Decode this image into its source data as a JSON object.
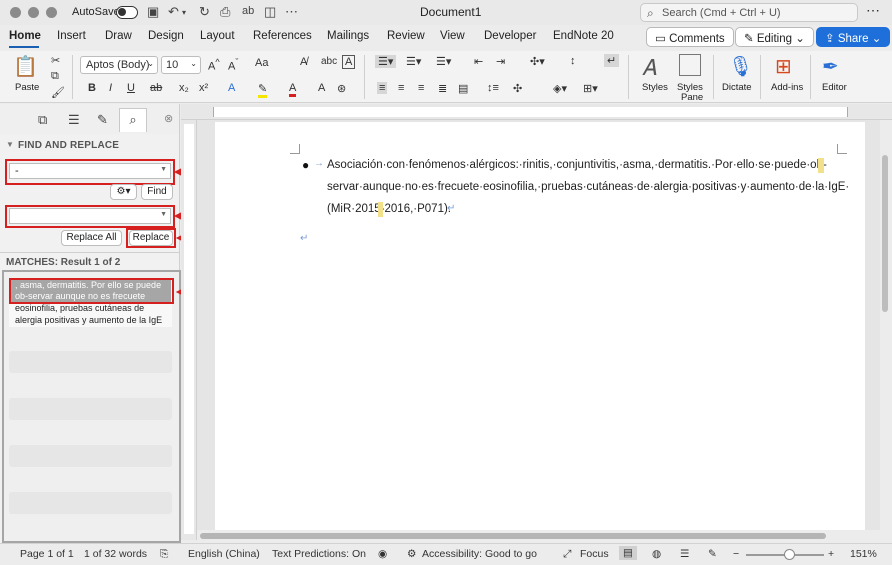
{
  "titlebar": {
    "autosave_label": "AutoSave",
    "doc_title": "Document1",
    "search_placeholder": "Search (Cmd + Ctrl + U)"
  },
  "tabs": [
    "Home",
    "Insert",
    "Draw",
    "Design",
    "Layout",
    "References",
    "Mailings",
    "Review",
    "View",
    "Developer",
    "EndNote 20"
  ],
  "active_tab": "Home",
  "header_buttons": {
    "comments": "Comments",
    "editing": "Editing",
    "share": "Share"
  },
  "ribbon": {
    "paste_label": "Paste",
    "font_name": "Aptos (Body)",
    "font_size": "10",
    "styles_label": "Styles",
    "styles_pane_label_1": "Styles",
    "styles_pane_label_2": "Pane",
    "dictate_label": "Dictate",
    "addins_label": "Add-ins",
    "editor_label": "Editor"
  },
  "find_replace": {
    "title": "FIND AND REPLACE",
    "find_value": "-",
    "replace_value": "",
    "find_button": "Find",
    "replace_all_button": "Replace All",
    "replace_button": "Replace",
    "matches_label": "MATCHES: Result 1 of 2",
    "match_lines": [
      ", asma, dermatitis. Por ello se puede",
      "ob-servar aunque no es frecuete",
      "eosinofilia, pruebas cutáneas de",
      "alergia positivas y aumento de la IgE"
    ]
  },
  "annotations": [
    "1",
    "2",
    "3",
    "4"
  ],
  "document": {
    "lines": [
      "Asociación·con·fenómenos·alérgicos:·rinitis,·conjuntivitis,·asma,·dermatitis.·Por·ello·se·puede·ob-",
      "servar·aunque·no·es·frecuete·eosinofilia,·pruebas·cutáneas·de·alergia·positivas·y·aumento·de·la·IgE·",
      "(MiR·2015-2016,·P071)."
    ]
  },
  "statusbar": {
    "page": "Page 1 of 1",
    "words": "1 of 32 words",
    "language": "English (China)",
    "text_predictions": "Text Predictions: On",
    "accessibility": "Accessibility: Good to go",
    "focus": "Focus",
    "zoom": "151%"
  },
  "colors": {
    "accent": "#1e6fd9",
    "annotation": "#d61f1f",
    "highlight": "#f2e08a"
  }
}
